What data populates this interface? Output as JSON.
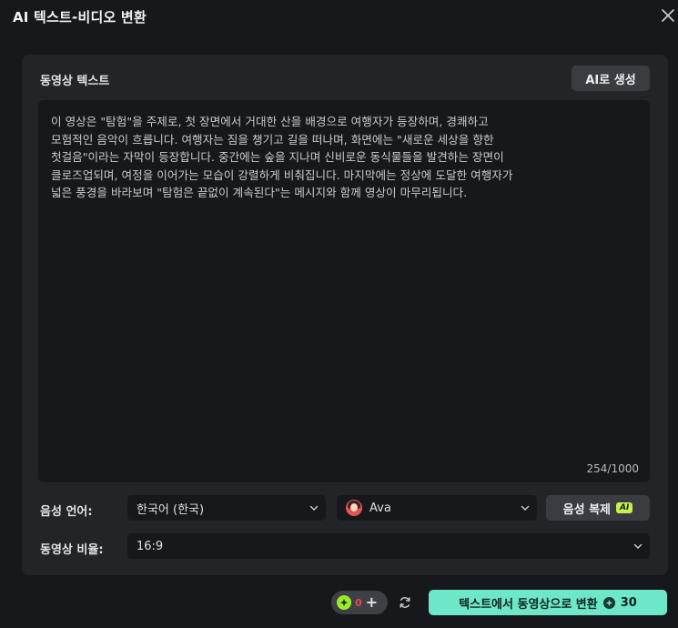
{
  "window": {
    "title": "AI 텍스트-비디오 변환"
  },
  "script_section": {
    "label": "동영상 텍스트",
    "ai_generate_label": "AI로 생성",
    "text": "이 영상은 \"탐험\"을 주제로, 첫 장면에서 거대한 산을 배경으로 여행자가 등장하며, 경쾌하고\n모험적인 음악이 흐릅니다. 여행자는 짐을 챙기고 길을 떠나며, 화면에는 \"새로운 세상을 향한\n첫걸음\"이라는 자막이 등장합니다. 중간에는 숲을 지나며 신비로운 동식물들을 발견하는 장면이\n클로즈업되며, 여정을 이어가는 모습이 강렬하게 비춰집니다. 마지막에는 정상에 도달한 여행자가\n넓은 풍경을 바라보며 \"탐험은 끝없이 계속된다\"는 메시지와 함께 영상이 마무리됩니다.",
    "char_count": "254/1000"
  },
  "voice": {
    "label": "음성 언어:",
    "language_value": "한국어 (한국)",
    "voice_value": "Ava",
    "clone_label": "음성 복제",
    "clone_badge": "AI"
  },
  "ratio": {
    "label": "동영상 비율:",
    "value": "16:9"
  },
  "footer": {
    "credit_value": "0",
    "convert_label": "텍스트에서 동영상으로 변환",
    "convert_cost": "30"
  },
  "colors": {
    "accent": "#6ee7c8",
    "ai_badge": "#c6f24a",
    "credit_icon": "#9bea2e",
    "credit_zero": "#e74a4a",
    "panel": "#222428",
    "background": "#17181b"
  }
}
